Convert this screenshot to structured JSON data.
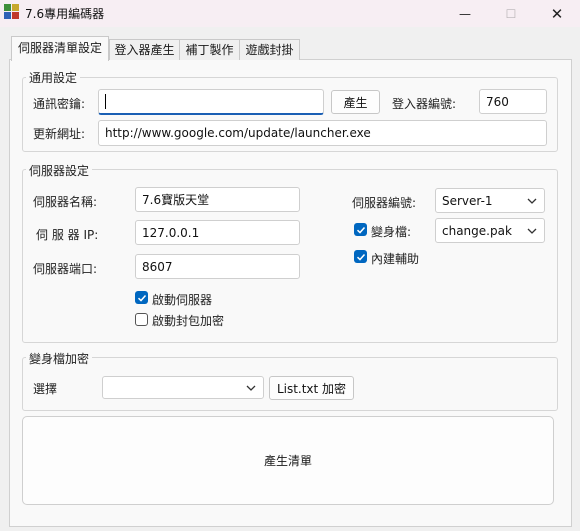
{
  "window": {
    "title": "7.6專用編碼器",
    "min_symbol": "—",
    "max_symbol": "☐",
    "close_symbol": "✕"
  },
  "tabs": [
    {
      "label": "伺服器清單設定",
      "active": true
    },
    {
      "label": "登入器產生",
      "active": false
    },
    {
      "label": "補丁製作",
      "active": false
    },
    {
      "label": "遊戲封掛",
      "active": false
    }
  ],
  "general": {
    "title": "通用設定",
    "secret_label": "通訊密鑰:",
    "secret_value": "",
    "generate_label": "產生",
    "launcher_id_label": "登入器編號:",
    "launcher_id_value": "760",
    "update_url_label": "更新網址:",
    "update_url_value": "http://www.google.com/update/launcher.exe"
  },
  "server": {
    "title": "伺服器設定",
    "name_label": "伺服器名稱:",
    "name_value": "7.6寶版天堂",
    "ip_label": "伺 服 器 IP:",
    "ip_value": "127.0.0.1",
    "port_label": "伺服器端口:",
    "port_value": "8607",
    "server_id_label": "伺服器編號:",
    "server_id_value": "Server-1",
    "morph_label": "變身檔:",
    "morph_checked": true,
    "morph_value": "change.pak",
    "builtin_label": "內建輔助",
    "builtin_checked": true,
    "enable_server_label": "啟動伺服器",
    "enable_server_checked": true,
    "enable_packet_label": "啟動封包加密",
    "enable_packet_checked": false
  },
  "morph_encrypt": {
    "title": "變身檔加密",
    "select_label": "選擇",
    "select_value": "",
    "encrypt_button": "List.txt 加密"
  },
  "generate_list_label": "產生清單"
}
